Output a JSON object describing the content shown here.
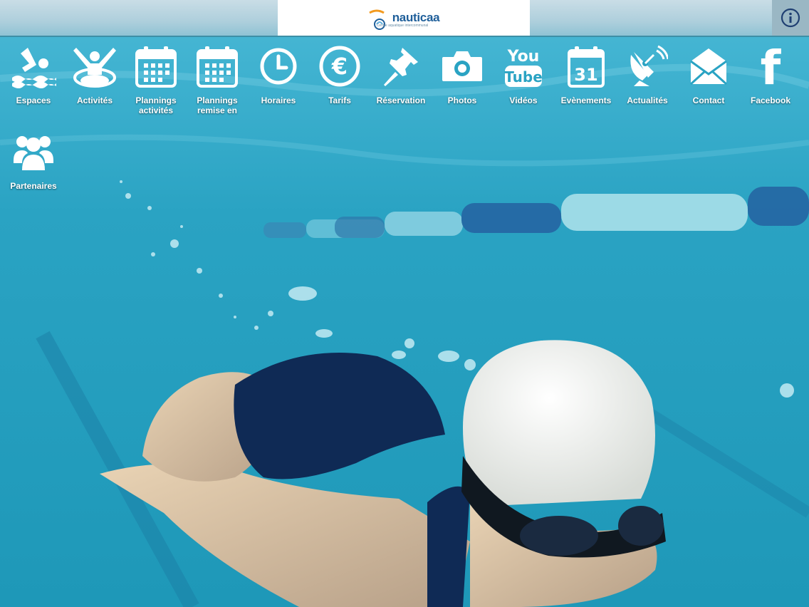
{
  "header": {
    "logo_text": "nauticaa",
    "logo_tagline": "Centre aquatique intercommunal",
    "info_icon": "info-icon"
  },
  "menu": {
    "items": [
      {
        "label": "Espaces",
        "icon": "swimmer-icon"
      },
      {
        "label": "Activités",
        "icon": "water-aerobics-icon"
      },
      {
        "label": "Plannings activités",
        "icon": "calendar-icon"
      },
      {
        "label": "Plannings remise en",
        "icon": "calendar-icon"
      },
      {
        "label": "Horaires",
        "icon": "clock-icon"
      },
      {
        "label": "Tarifs",
        "icon": "euro-icon"
      },
      {
        "label": "Réservation",
        "icon": "pushpin-icon"
      },
      {
        "label": "Photos",
        "icon": "camera-icon"
      },
      {
        "label": "Vidéos",
        "icon": "youtube-icon"
      },
      {
        "label": "Evènements",
        "icon": "calendar-31-icon"
      },
      {
        "label": "Actualités",
        "icon": "satellite-dish-icon"
      },
      {
        "label": "Contact",
        "icon": "envelope-icon"
      },
      {
        "label": "Facebook",
        "icon": "facebook-icon"
      },
      {
        "label": "Partenaires",
        "icon": "group-icon"
      }
    ],
    "youtube_you": "You",
    "youtube_tube": "Tube",
    "calendar_day": "31",
    "euro_symbol": "€",
    "facebook_letter": "f"
  },
  "colors": {
    "water": "#2aa6c4",
    "icon": "#ffffff",
    "logo_blue": "#1f5f9a",
    "logo_orange": "#f39a1e"
  }
}
